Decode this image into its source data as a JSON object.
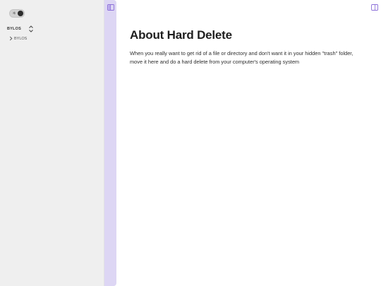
{
  "sidebar": {
    "vault": {
      "name": "BYLOS"
    },
    "tree": [
      {
        "label": "BYLOS"
      }
    ]
  },
  "icons": {
    "theme_sun": "sun-icon",
    "theme_moon": "moon-icon",
    "vault_switch": "chevron-up-down-icon",
    "left_panel": "sidebar-left-icon",
    "right_panel": "sidebar-right-icon",
    "tree_chevron": "chevron-right-icon"
  },
  "colors": {
    "sidebar_bg": "#efefef",
    "strip_bg": "#ddd6f4",
    "accent": "#8b6fd8"
  },
  "main": {
    "title": "About Hard Delete",
    "body": "When you really want to get rid of a file or directory and don't want it in your hidden \"trash\" folder, move it here and do a hard delete from your computer's operating system"
  }
}
